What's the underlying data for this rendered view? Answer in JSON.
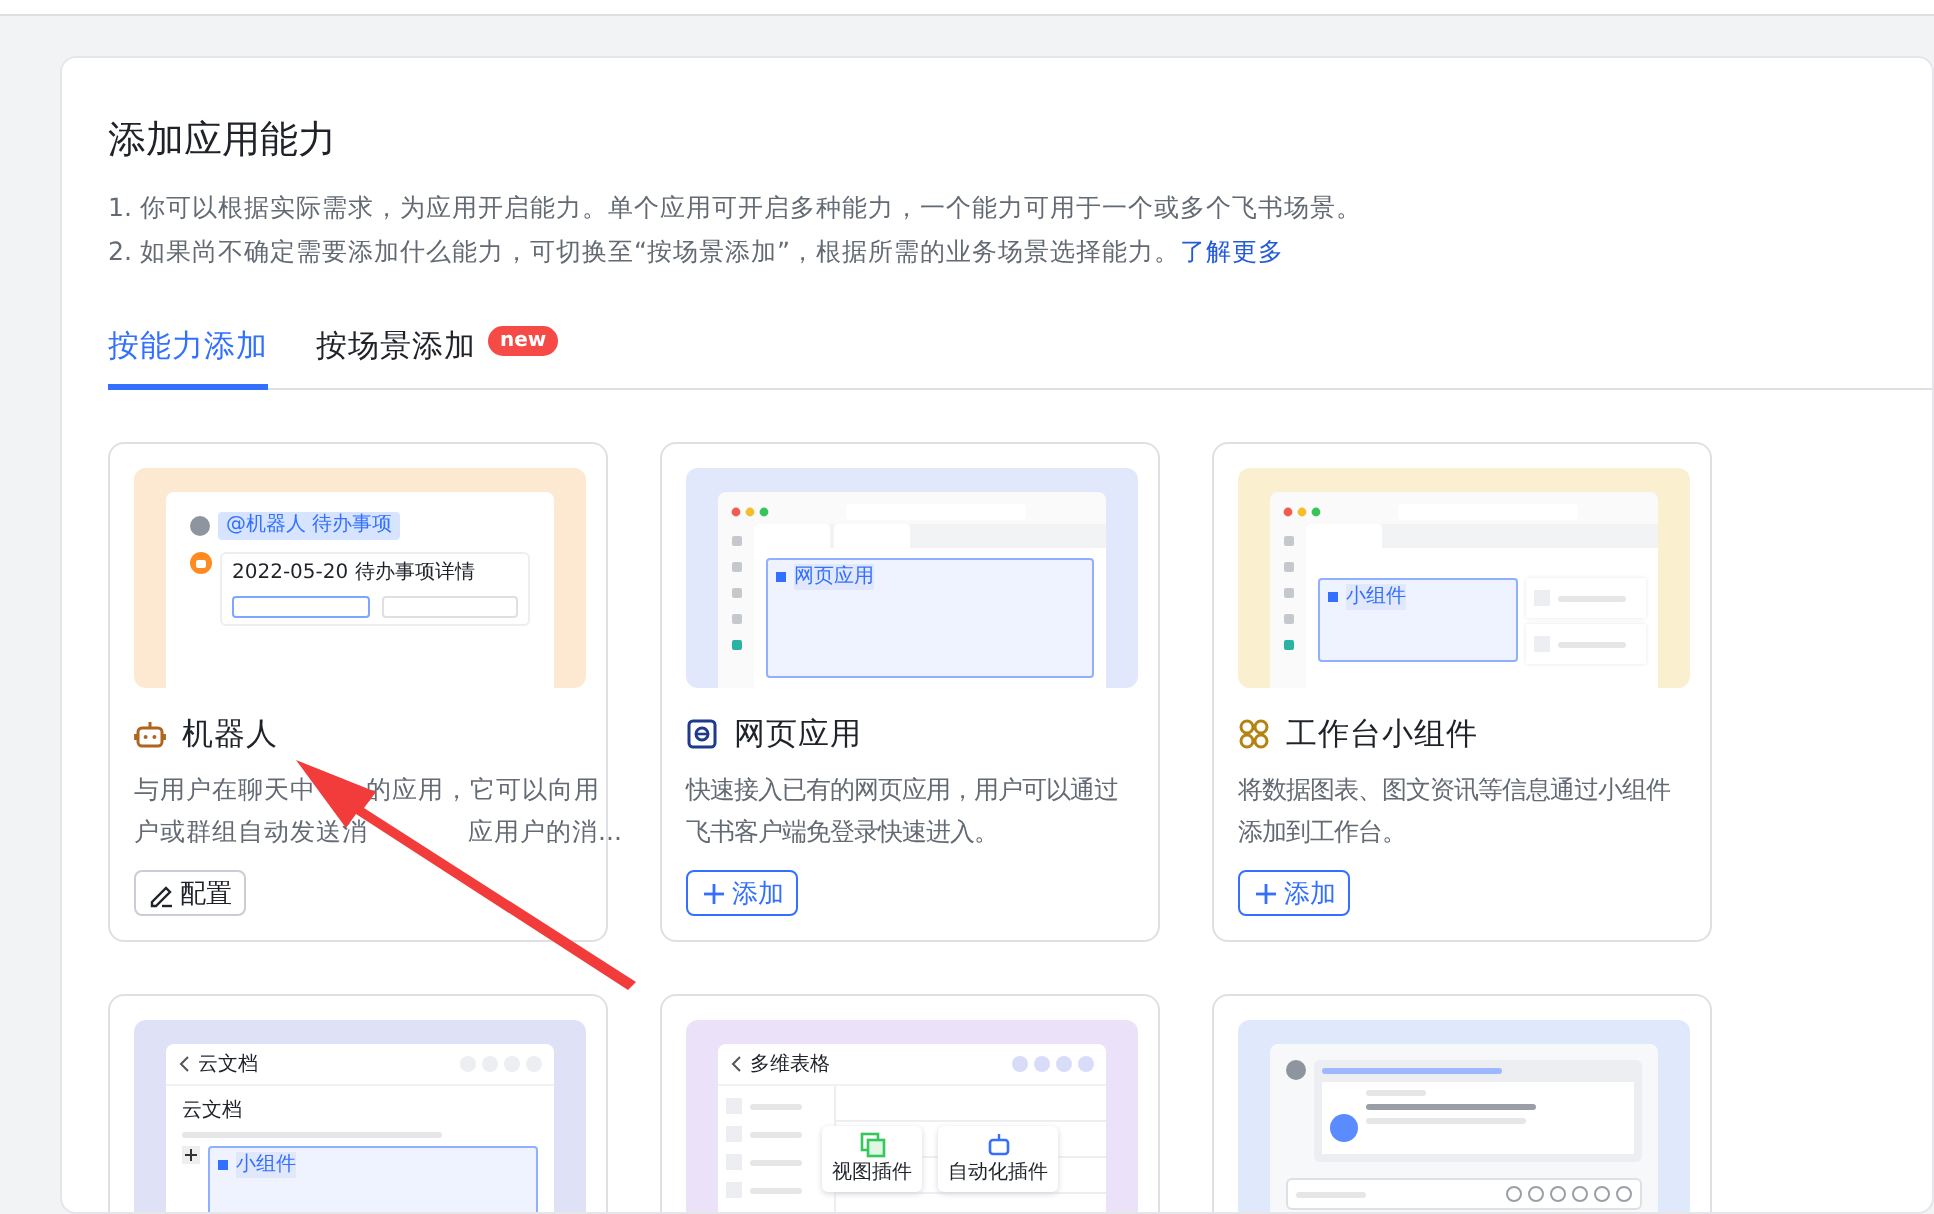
{
  "header": {
    "title": "添加应用能力",
    "notes": [
      "1. 你可以根据实际需求，为应用开启能力。单个应用可开启多种能力，一个能力可用于一个或多个飞书场景。",
      "2. 如果尚不确定需要添加什么能力，可切换至“按场景添加”，根据所需的业务场景选择能力。"
    ],
    "learn_more": "了解更多"
  },
  "tabs": [
    {
      "label": "按能力添加",
      "selected": true
    },
    {
      "label": "按场景添加",
      "selected": false,
      "badge": "new"
    }
  ],
  "cards": [
    {
      "kind": "bot",
      "title": "机器人",
      "description_lines": [
        [
          "与用户在聊天中",
          "的应用，它可以向用"
        ],
        [
          "户或群组自动发送消",
          "应用户的消..."
        ]
      ],
      "button": {
        "kind": "edit",
        "label": "配置"
      },
      "preview": {
        "kind": "chat",
        "texts": [
          "@机器人 待办事项",
          "2022-05-20 待办事项详情"
        ]
      }
    },
    {
      "kind": "web",
      "title": "网页应用",
      "description": "快速接入已有的网页应用，用户可以通过飞书客户端免登录快速进入。",
      "button": {
        "kind": "add",
        "label": "添加"
      },
      "preview": {
        "kind": "web",
        "texts": [
          "网页应用"
        ]
      }
    },
    {
      "kind": "widget",
      "title": "工作台小组件",
      "description": "将数据图表、图文资讯等信息通过小组件添加到工作台。",
      "button": {
        "kind": "add",
        "label": "添加"
      },
      "preview": {
        "kind": "widget",
        "texts": [
          "小组件"
        ]
      }
    },
    {
      "preview": {
        "kind": "doc",
        "texts": [
          "云文档",
          "云文档",
          "小组件"
        ]
      }
    },
    {
      "preview": {
        "kind": "table",
        "texts": [
          "多维表格",
          "视图插件",
          "自动化插件"
        ]
      }
    },
    {
      "preview": {
        "kind": "message"
      }
    }
  ],
  "annotation_arrow": true
}
